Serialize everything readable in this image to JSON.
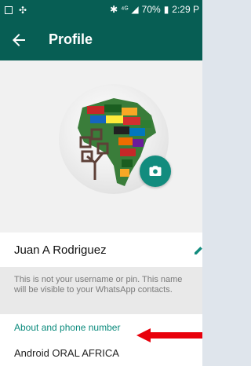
{
  "status_bar": {
    "signal_text": "⁴ᴳ",
    "battery": "70%",
    "time": "2:29 P"
  },
  "toolbar": {
    "title": "Profile"
  },
  "profile": {
    "name": "Juan A Rodriguez",
    "name_hint": "This is not your username or pin. This name will be visible to your WhatsApp contacts."
  },
  "about": {
    "label": "About and phone number",
    "value": "Android ORAL AFRICA"
  },
  "colors": {
    "toolbar": "#075e54",
    "accent": "#128c7e",
    "label_green": "#0a8a7c",
    "annotation_arrow": "#e8000b"
  }
}
